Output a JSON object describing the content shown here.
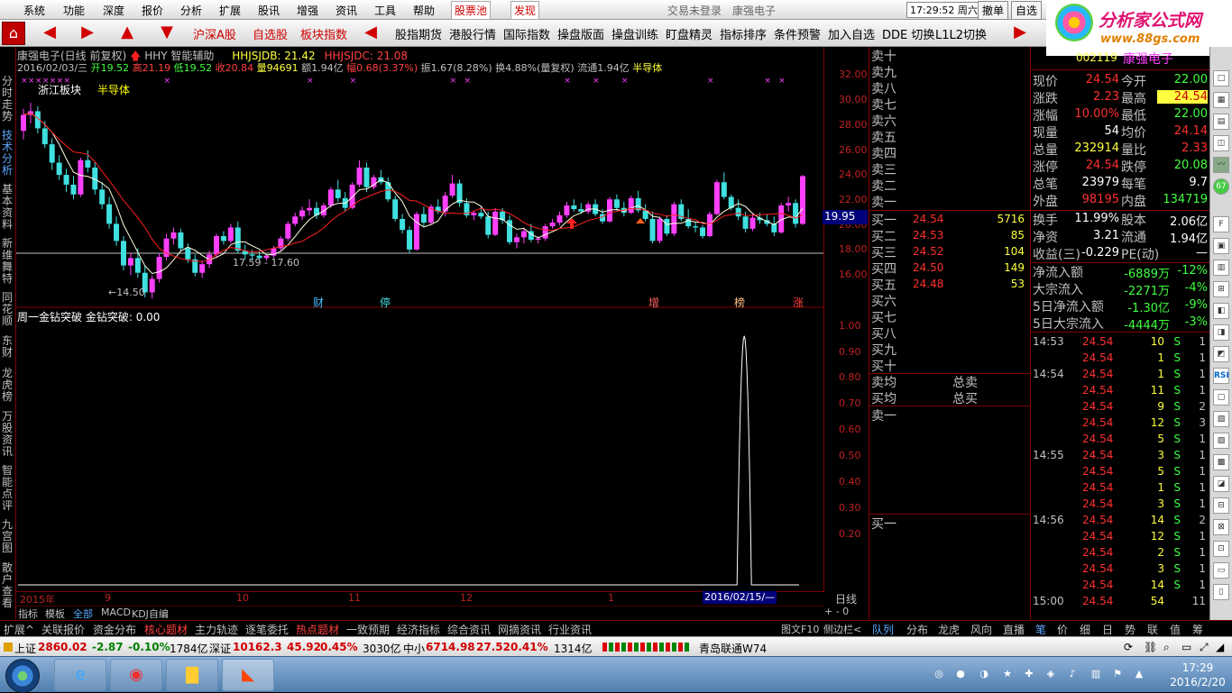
{
  "menu": {
    "items": [
      "系统",
      "功能",
      "深度",
      "报价",
      "分析",
      "扩展",
      "股讯",
      "增强",
      "资讯",
      "工具",
      "帮助"
    ],
    "red_items": [
      "股票池",
      "发现"
    ],
    "center_title": "交易未登录",
    "center_stock": "康强电子",
    "clock": "17:29:52 周六",
    "btn_cancel": "撤单",
    "btn_self": "自选"
  },
  "logo": {
    "line1": "分析家公式网",
    "line2": "www.88gs.com"
  },
  "toolbar": {
    "home": "⌂",
    "items": [
      "沪深A股",
      "自选股",
      "板块指数",
      "股指期货",
      "港股行情",
      "国际指数",
      "操盘版面",
      "操盘训练",
      "盯盘精灵",
      "指标排序",
      "条件预警",
      "加入自选",
      "DDE 切换",
      "L1L2切换"
    ],
    "red_items": [
      "沪深A股",
      "自选股",
      "板块指数"
    ]
  },
  "left_sidebar": {
    "items": [
      "分时走势",
      "技术分析",
      "基本资料",
      "新维舞特",
      "同花顺",
      "东财",
      "龙虎榜",
      "万股资讯",
      "智能点评",
      "九宫图",
      "散户查看"
    ],
    "selected": "技术分析"
  },
  "upper_chart": {
    "title_stock": "康强电子(日线 前复权)",
    "indicator_name": "HHY 智能辅助",
    "hhjsjdb": "HHJSJDB: 21.42",
    "hhjsjdc": "HHJSJDC: 21.08",
    "date": "2016/02/03/三",
    "open": "开19.52",
    "high": "高21.19",
    "low": "低19.52",
    "close": "收20.84",
    "volume": "量94691",
    "amount": "额1.94亿",
    "change": "幅0.68(3.37%)",
    "amplitude": "振1.67(8.28%)",
    "turnover": "换4.88%(量复权)",
    "float": "流通1.94亿",
    "sector": "半导体",
    "region_label": "浙江板块",
    "region_sector": "半导体",
    "min_label": "←14.50",
    "range_label": "17.59 - 17.60",
    "event_labels": [
      "财",
      "停",
      "增",
      "榜",
      "涨"
    ],
    "current_price_box": "19.95"
  },
  "lower_chart": {
    "title": "周一金钻突破",
    "indicator": "金钻突破: 0.00"
  },
  "y_axis_upper": [
    "32.00",
    "30.00",
    "28.00",
    "26.00",
    "24.00",
    "22.00",
    "20.00",
    "18.00",
    "16.00"
  ],
  "y_axis_lower": [
    "1.00",
    "0.90",
    "0.80",
    "0.70",
    "0.60",
    "0.50",
    "0.40",
    "0.30",
    "0.20"
  ],
  "x_axis": {
    "labels": [
      "2015年",
      "9",
      "10",
      "11",
      "12",
      "1"
    ],
    "selected": "2016/02/15/—",
    "period": "日线"
  },
  "bottom_tabs": {
    "items": [
      "指标",
      "模板",
      "全部",
      "MACD",
      "KDJ自编"
    ],
    "selected": "全部",
    "ctrl": "+ - 0"
  },
  "orderbook": {
    "sell_labels": [
      "卖十",
      "卖九",
      "卖八",
      "卖七",
      "卖六",
      "卖五",
      "卖四",
      "卖三",
      "卖二",
      "卖一"
    ],
    "buy_rows": [
      {
        "label": "买一",
        "price": "24.54",
        "vol": "5716"
      },
      {
        "label": "买二",
        "price": "24.53",
        "vol": "85"
      },
      {
        "label": "买三",
        "price": "24.52",
        "vol": "104"
      },
      {
        "label": "买四",
        "price": "24.50",
        "vol": "149"
      },
      {
        "label": "买五",
        "price": "24.48",
        "vol": "53"
      }
    ],
    "buy_more": [
      "买六",
      "买七",
      "买八",
      "买九",
      "买十"
    ],
    "avg_sell": "卖均",
    "avg_buy": "买均",
    "total_sell": "总卖",
    "total_buy": "总买",
    "sell1_label": "卖一",
    "buy1_label": "买一"
  },
  "quote": {
    "code": "002119",
    "name": "康强电子",
    "rows": [
      {
        "l1": "现价",
        "v1": "24.54",
        "c1": "#ff3030",
        "l2": "今开",
        "v2": "22.00",
        "c2": "#40ff40"
      },
      {
        "l1": "涨跌",
        "v1": "2.23",
        "c1": "#ff3030",
        "l2": "最高",
        "v2": "24.54",
        "c2": "#ff3030",
        "hl2": true
      },
      {
        "l1": "涨幅",
        "v1": "10.00%",
        "c1": "#ff3030",
        "l2": "最低",
        "v2": "22.00",
        "c2": "#40ff40"
      },
      {
        "l1": "现量",
        "v1": "54",
        "c1": "#ffffff",
        "l2": "均价",
        "v2": "24.14",
        "c2": "#ff3030"
      },
      {
        "l1": "总量",
        "v1": "232914",
        "c1": "#ffff40",
        "l2": "量比",
        "v2": "2.33",
        "c2": "#ff3030"
      },
      {
        "l1": "涨停",
        "v1": "24.54",
        "c1": "#ff3030",
        "l2": "跌停",
        "v2": "20.08",
        "c2": "#40ff40"
      },
      {
        "l1": "总笔",
        "v1": "23979",
        "c1": "#ffffff",
        "l2": "每笔",
        "v2": "9.7",
        "c2": "#ffffff"
      },
      {
        "l1": "外盘",
        "v1": "98195",
        "c1": "#ff3030",
        "l2": "内盘",
        "v2": "134719",
        "c2": "#40ff40"
      }
    ],
    "rows2": [
      {
        "l1": "换手",
        "v1": "11.99%",
        "c1": "#ffffff",
        "l2": "股本",
        "v2": "2.06亿",
        "c2": "#ffffff"
      },
      {
        "l1": "净资",
        "v1": "3.21",
        "c1": "#ffffff",
        "l2": "流通",
        "v2": "1.94亿",
        "c2": "#ffffff"
      },
      {
        "l1": "收益(三)",
        "v1": "-0.229",
        "c1": "#ffffff",
        "l2": "PE(动)",
        "v2": "—",
        "c2": "#ffffff"
      }
    ],
    "flows": [
      {
        "l": "净流入额",
        "v": "-6889万",
        "p": "-12%"
      },
      {
        "l": "大宗流入",
        "v": "-2271万",
        "p": "-4%"
      },
      {
        "l": "5日净流入额",
        "v": "-1.30亿",
        "p": "-9%"
      },
      {
        "l": "5日大宗流入",
        "v": "-4444万",
        "p": "-3%"
      }
    ],
    "ticks": [
      {
        "t": "14:53",
        "p": "24.54",
        "v": "10",
        "d": "S",
        "n": "1"
      },
      {
        "t": "",
        "p": "24.54",
        "v": "1",
        "d": "S",
        "n": "1"
      },
      {
        "t": "14:54",
        "p": "24.54",
        "v": "1",
        "d": "S",
        "n": "1"
      },
      {
        "t": "",
        "p": "24.54",
        "v": "11",
        "d": "S",
        "n": "1"
      },
      {
        "t": "",
        "p": "24.54",
        "v": "9",
        "d": "S",
        "n": "2"
      },
      {
        "t": "",
        "p": "24.54",
        "v": "12",
        "d": "S",
        "n": "3"
      },
      {
        "t": "",
        "p": "24.54",
        "v": "5",
        "d": "S",
        "n": "1"
      },
      {
        "t": "14:55",
        "p": "24.54",
        "v": "3",
        "d": "S",
        "n": "1"
      },
      {
        "t": "",
        "p": "24.54",
        "v": "5",
        "d": "S",
        "n": "1"
      },
      {
        "t": "",
        "p": "24.54",
        "v": "1",
        "d": "S",
        "n": "1"
      },
      {
        "t": "",
        "p": "24.54",
        "v": "3",
        "d": "S",
        "n": "1"
      },
      {
        "t": "14:56",
        "p": "24.54",
        "v": "14",
        "d": "S",
        "n": "2"
      },
      {
        "t": "",
        "p": "24.54",
        "v": "12",
        "d": "S",
        "n": "1"
      },
      {
        "t": "",
        "p": "24.54",
        "v": "2",
        "d": "S",
        "n": "1"
      },
      {
        "t": "",
        "p": "24.54",
        "v": "3",
        "d": "S",
        "n": "1"
      },
      {
        "t": "",
        "p": "24.54",
        "v": "14",
        "d": "S",
        "n": "1"
      },
      {
        "t": "15:00",
        "p": "24.54",
        "v": "54",
        "d": "",
        "n": "11"
      }
    ]
  },
  "panel_bar": {
    "items": [
      "扩展^",
      "关联报价",
      "资金分布",
      "核心题材",
      "主力轨迹",
      "逐笔委托",
      "热点题材",
      "一致预期",
      "经济指标",
      "综合资讯",
      "网摘资讯",
      "行业资讯"
    ],
    "red_items": [
      "核心题材",
      "热点题材"
    ],
    "right": [
      "图文F10",
      "侧边栏<"
    ],
    "right_tabs": [
      "队列",
      "分布",
      "龙虎",
      "风向",
      "直播",
      "笔",
      "价",
      "细",
      "日",
      "势",
      "联",
      "值",
      "筹"
    ]
  },
  "index_bar": {
    "sh_name": "上证",
    "sh_val": "2860.02",
    "sh_chg": "-2.87",
    "sh_pct": "-0.10%",
    "sh_amt": "1784亿",
    "sz_name": "深证",
    "sz_val": "10162.3",
    "sz_chg": "45.92",
    "sz_pct": "0.45%",
    "sz_amt": "3030亿",
    "zx_name": "中小",
    "zx_val": "6714.98",
    "zx_chg": "27.52",
    "zx_pct": "0.41%",
    "zx_amt": "1314亿",
    "broker": "青岛联通W74"
  },
  "taskbar": {
    "time": "17:29",
    "date": "2016/2/20"
  },
  "chart_data": {
    "type": "candlestick",
    "ylim": [
      14,
      33
    ],
    "ma_colors": [
      "#ffffe0",
      "#ff2020"
    ],
    "candle_up_color": "#ff40ff",
    "candle_down_color": "#40e0e0",
    "lower_ylim": [
      0,
      1.05
    ],
    "lower_spike_index": 0.925,
    "candles": [
      [
        28.2,
        30.0,
        27.5,
        29.5
      ],
      [
        29.5,
        30.5,
        28.8,
        29.8
      ],
      [
        29.8,
        30.2,
        28.0,
        28.4
      ],
      [
        28.4,
        29.0,
        26.8,
        27.1
      ],
      [
        27.1,
        27.6,
        25.0,
        25.6
      ],
      [
        25.6,
        26.2,
        24.2,
        24.6
      ],
      [
        24.6,
        25.1,
        23.2,
        23.8
      ],
      [
        23.8,
        24.5,
        22.6,
        23.0
      ],
      [
        23.0,
        26.0,
        22.8,
        25.8
      ],
      [
        25.8,
        26.6,
        24.8,
        25.2
      ],
      [
        25.2,
        25.6,
        23.0,
        23.4
      ],
      [
        23.4,
        24.0,
        21.8,
        22.2
      ],
      [
        22.2,
        22.8,
        20.2,
        20.6
      ],
      [
        20.6,
        21.2,
        18.8,
        19.2
      ],
      [
        19.2,
        19.6,
        16.8,
        17.2
      ],
      [
        17.2,
        18.2,
        16.4,
        17.8
      ],
      [
        17.8,
        18.6,
        16.2,
        16.6
      ],
      [
        16.6,
        17.2,
        14.6,
        15.0
      ],
      [
        15.0,
        16.4,
        14.5,
        16.1
      ],
      [
        16.1,
        18.2,
        15.8,
        17.9
      ],
      [
        17.9,
        19.8,
        17.6,
        19.4
      ],
      [
        19.4,
        20.3,
        18.9,
        19.9
      ],
      [
        19.9,
        20.2,
        18.4,
        18.6
      ],
      [
        18.6,
        19.0,
        17.4,
        17.7
      ],
      [
        17.7,
        18.1,
        16.3,
        16.6
      ],
      [
        16.6,
        17.6,
        16.2,
        17.3
      ],
      [
        17.3,
        18.4,
        17.0,
        18.1
      ],
      [
        18.1,
        19.8,
        17.8,
        19.6
      ],
      [
        19.6,
        20.0,
        18.9,
        19.2
      ],
      [
        19.2,
        20.6,
        19.0,
        20.3
      ],
      [
        20.3,
        20.8,
        18.2,
        18.4
      ],
      [
        18.4,
        18.9,
        17.7,
        18.1
      ],
      [
        18.1,
        18.5,
        17.6,
        18.0
      ],
      [
        18.0,
        18.4,
        17.7,
        17.8
      ],
      [
        17.8,
        18.1,
        17.6,
        18.0
      ],
      [
        18.0,
        18.8,
        17.8,
        18.6
      ],
      [
        18.6,
        19.6,
        18.4,
        19.4
      ],
      [
        19.4,
        20.8,
        19.2,
        20.6
      ],
      [
        20.6,
        21.5,
        20.4,
        21.2
      ],
      [
        21.2,
        22.0,
        20.9,
        21.7
      ],
      [
        21.7,
        22.6,
        21.3,
        21.9
      ],
      [
        21.9,
        22.4,
        21.0,
        21.3
      ],
      [
        21.3,
        22.3,
        21.1,
        22.1
      ],
      [
        22.1,
        23.6,
        21.9,
        23.4
      ],
      [
        23.4,
        24.2,
        22.4,
        22.7
      ],
      [
        22.7,
        23.2,
        21.6,
        21.9
      ],
      [
        21.9,
        24.0,
        21.8,
        23.8
      ],
      [
        23.8,
        25.8,
        23.6,
        25.2
      ],
      [
        25.2,
        25.6,
        23.2,
        23.6
      ],
      [
        23.6,
        24.6,
        23.4,
        24.4
      ],
      [
        24.4,
        25.0,
        23.8,
        24.0
      ],
      [
        24.0,
        24.4,
        22.4,
        22.6
      ],
      [
        22.6,
        22.9,
        20.8,
        21.0
      ],
      [
        21.0,
        21.4,
        19.8,
        20.1
      ],
      [
        20.1,
        20.4,
        18.2,
        18.5
      ],
      [
        18.5,
        21.6,
        18.4,
        21.4
      ],
      [
        21.4,
        22.0,
        20.4,
        20.7
      ],
      [
        20.7,
        22.2,
        20.5,
        22.0
      ],
      [
        22.0,
        22.6,
        21.4,
        21.6
      ],
      [
        21.6,
        23.2,
        21.2,
        22.9
      ],
      [
        22.9,
        24.6,
        22.7,
        23.9
      ],
      [
        23.9,
        24.2,
        22.0,
        22.3
      ],
      [
        22.3,
        22.7,
        21.1,
        21.3
      ],
      [
        21.3,
        21.7,
        20.9,
        21.5
      ],
      [
        21.5,
        22.0,
        21.0,
        21.2
      ],
      [
        21.2,
        21.6,
        19.4,
        19.7
      ],
      [
        19.7,
        21.9,
        19.6,
        21.6
      ],
      [
        21.6,
        21.9,
        20.6,
        20.9
      ],
      [
        20.9,
        21.3,
        18.9,
        19.1
      ],
      [
        19.1,
        19.8,
        18.6,
        19.5
      ],
      [
        19.5,
        20.3,
        19.0,
        20.0
      ],
      [
        20.0,
        20.6,
        19.1,
        19.3
      ],
      [
        19.3,
        19.6,
        19.0,
        19.4
      ],
      [
        19.4,
        20.6,
        19.2,
        20.4
      ],
      [
        20.4,
        21.0,
        20.2,
        20.7
      ],
      [
        20.7,
        21.6,
        20.5,
        21.3
      ],
      [
        21.3,
        22.4,
        21.1,
        22.1
      ],
      [
        22.1,
        22.6,
        21.6,
        21.8
      ],
      [
        21.8,
        22.3,
        21.4,
        21.6
      ],
      [
        21.6,
        22.4,
        21.4,
        22.2
      ],
      [
        22.2,
        22.6,
        21.2,
        21.4
      ],
      [
        21.4,
        21.8,
        20.6,
        20.8
      ],
      [
        20.8,
        22.8,
        20.7,
        22.6
      ],
      [
        22.6,
        23.0,
        21.6,
        21.9
      ],
      [
        21.9,
        22.4,
        21.2,
        21.5
      ],
      [
        21.5,
        22.9,
        21.4,
        22.7
      ],
      [
        22.7,
        23.3,
        21.5,
        21.7
      ],
      [
        21.7,
        22.2,
        20.8,
        21.0
      ],
      [
        21.0,
        21.6,
        19.0,
        19.2
      ],
      [
        19.2,
        21.2,
        19.0,
        21.0
      ],
      [
        21.0,
        21.3,
        19.6,
        19.8
      ],
      [
        19.8,
        22.4,
        19.6,
        22.2
      ],
      [
        22.2,
        22.6,
        20.8,
        21.0
      ],
      [
        21.0,
        21.8,
        20.2,
        20.4
      ],
      [
        20.4,
        20.8,
        19.9,
        20.3
      ],
      [
        20.3,
        20.5,
        19.4,
        19.6
      ],
      [
        19.6,
        21.6,
        19.5,
        21.4
      ],
      [
        21.4,
        24.2,
        21.3,
        24.0
      ],
      [
        24.0,
        24.8,
        22.6,
        22.8
      ],
      [
        22.8,
        23.0,
        21.7,
        21.9
      ],
      [
        21.9,
        22.6,
        20.9,
        21.2
      ],
      [
        21.2,
        21.6,
        19.9,
        20.2
      ],
      [
        20.2,
        21.4,
        20.0,
        21.1
      ],
      [
        21.1,
        21.5,
        20.6,
        20.9
      ],
      [
        20.9,
        21.4,
        20.4,
        20.6
      ],
      [
        20.6,
        21.2,
        19.6,
        19.9
      ],
      [
        19.9,
        22.3,
        19.8,
        22.1
      ],
      [
        22.1,
        22.8,
        21.6,
        22.3
      ],
      [
        22.3,
        22.6,
        20.3,
        20.6
      ],
      [
        20.6,
        24.6,
        20.5,
        24.5
      ]
    ]
  }
}
